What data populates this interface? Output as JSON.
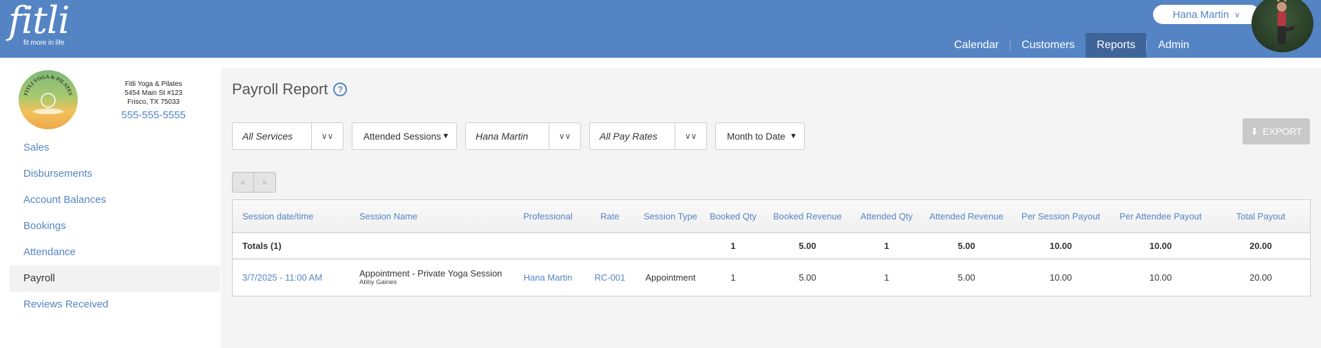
{
  "header": {
    "logo_text": "fitli",
    "logo_tagline": "fit more in life",
    "user_name": "Hana Martin",
    "nav": [
      {
        "label": "Calendar"
      },
      {
        "label": "Customers"
      },
      {
        "label": "Reports",
        "active": true
      },
      {
        "label": "Admin"
      }
    ]
  },
  "business": {
    "name": "Fitli Yoga & Pilates",
    "address1": "5454 Main St #123",
    "address2": "Frisco, TX 75033",
    "phone": "555-555-5555",
    "logo_text": "FITLI YOGA & PILATES"
  },
  "sidebar": {
    "items": [
      {
        "label": "Sales"
      },
      {
        "label": "Disbursements"
      },
      {
        "label": "Account Balances"
      },
      {
        "label": "Bookings"
      },
      {
        "label": "Attendance"
      },
      {
        "label": "Payroll",
        "active": true
      },
      {
        "label": "Reviews Received"
      }
    ]
  },
  "report": {
    "title": "Payroll Report",
    "help_icon": "question-circle-icon",
    "filters": {
      "services": "All Services",
      "sessions": "Attended Sessions",
      "professional": "Hana Martin",
      "pay_rates": "All Pay Rates",
      "period": "Month to Date"
    },
    "export_label": "EXPORT",
    "pager": {
      "prev": "«",
      "next": "»"
    },
    "columns": [
      "Session date/time",
      "Session Name",
      "Professional",
      "Rate",
      "Session Type",
      "Booked Qty",
      "Booked Revenue",
      "Attended Qty",
      "Attended Revenue",
      "Per Session Payout",
      "Per Attendee Payout",
      "Total Payout"
    ],
    "totals": {
      "label": "Totals (1)",
      "booked_qty": "1",
      "booked_revenue": "5.00",
      "attended_qty": "1",
      "attended_revenue": "5.00",
      "per_session_payout": "10.00",
      "per_attendee_payout": "10.00",
      "total_payout": "20.00"
    },
    "rows": [
      {
        "datetime": "3/7/2025 - 11:00 AM",
        "session_name": "Appointment - Private Yoga Session",
        "attendee": "Abby Gaines",
        "professional": "Hana Martin",
        "rate": "RC-001",
        "session_type": "Appointment",
        "booked_qty": "1",
        "booked_revenue": "5.00",
        "attended_qty": "1",
        "attended_revenue": "5.00",
        "per_session_payout": "10.00",
        "per_attendee_payout": "10.00",
        "total_payout": "20.00"
      }
    ]
  },
  "colors": {
    "header_bg": "#5584c4",
    "nav_active_bg": "#3e649a",
    "link": "#5584c4",
    "export_disabled": "#c9c9c9"
  }
}
